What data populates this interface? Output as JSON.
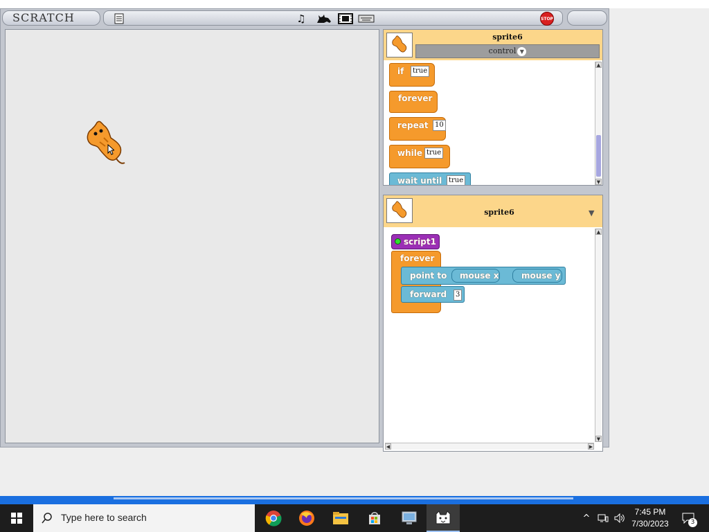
{
  "app": {
    "logo_text": "SCRATCH",
    "stop_label": "STOP"
  },
  "toolbar": {
    "icons": [
      "notes-icon",
      "music-note-icon",
      "cat-icon",
      "film-icon",
      "keyboard-icon"
    ]
  },
  "palette": {
    "sprite_name": "sprite6",
    "category": "control",
    "blocks": [
      {
        "label": "if",
        "slot": "true"
      },
      {
        "label": "forever"
      },
      {
        "label": "repeat",
        "slot": "10"
      },
      {
        "label": "while",
        "slot": "true"
      },
      {
        "label": "wait until",
        "slot": "true"
      }
    ]
  },
  "script_panel": {
    "sprite_name": "sprite6",
    "script": {
      "hat": "script1",
      "loop": "forever",
      "point_to": "point to",
      "reporter_x": "mouse x",
      "reporter_y": "mouse y",
      "forward": "forward",
      "forward_value": "3"
    }
  },
  "taskbar": {
    "search_placeholder": "Type here to search",
    "time": "7:45 PM",
    "date": "7/30/2023",
    "notification_count": "3",
    "apps": [
      "chrome",
      "firefox",
      "file-explorer",
      "microsoft-store",
      "remote-desktop",
      "scratch"
    ]
  },
  "colors": {
    "control_block": "#f59a2c",
    "motion_block": "#6bbad6",
    "script_hat": "#9b2fb6",
    "panel_header": "#fcd68a",
    "taskbar": "#1d1d1d"
  }
}
